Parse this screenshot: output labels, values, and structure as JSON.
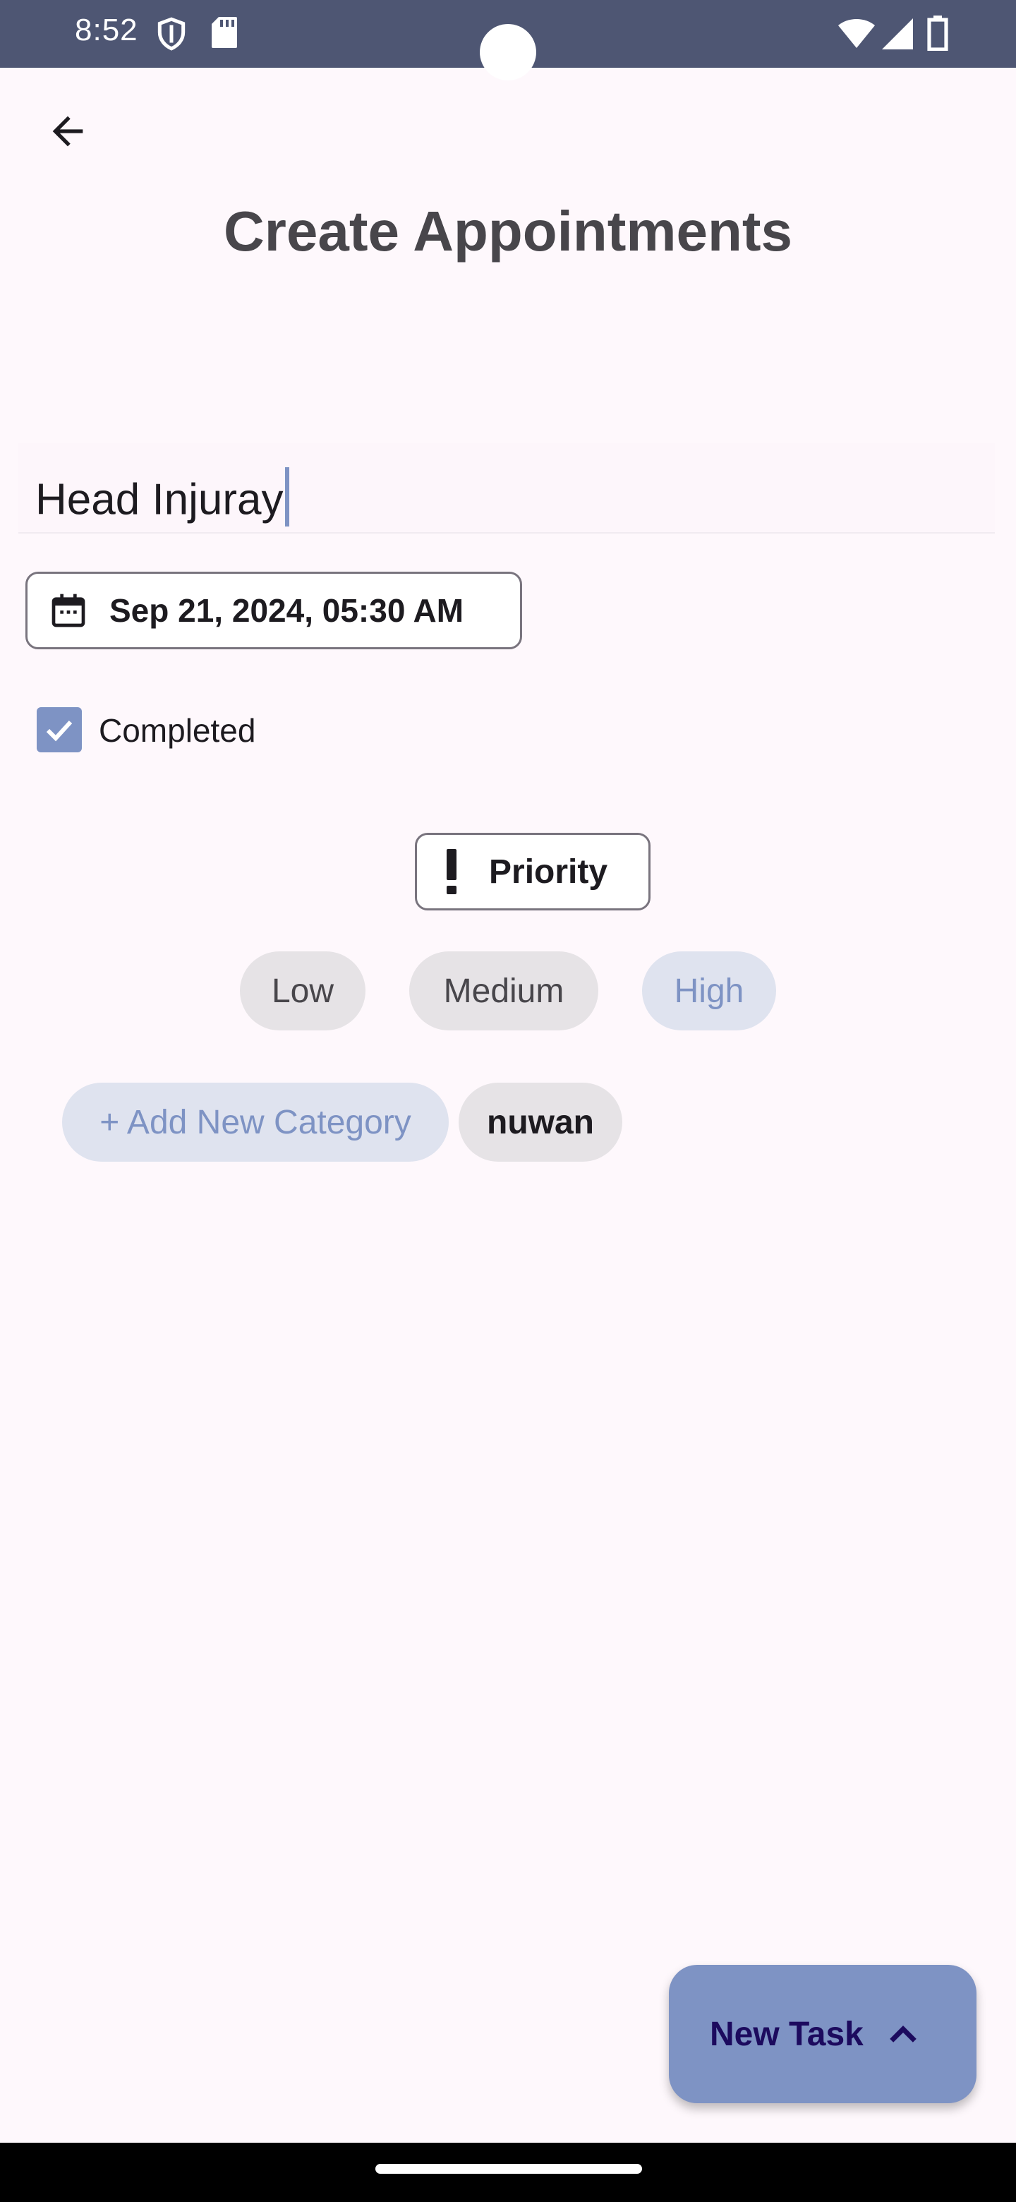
{
  "status_bar": {
    "time": "8:52",
    "left_icons": [
      "shield-icon",
      "sd-card-icon"
    ],
    "right_icons": [
      "wifi-icon",
      "signal-icon",
      "battery-icon"
    ]
  },
  "header": {
    "back_icon": "arrow-back-icon",
    "title": "Create Appointments"
  },
  "form": {
    "title_value": "Head Injuray",
    "date": {
      "icon": "calendar-icon",
      "label": "Sep 21, 2024, 05:30 AM"
    },
    "completed": {
      "checked": true,
      "label": "Completed"
    },
    "priority": {
      "icon": "exclamation-icon",
      "label": "Priority",
      "options": [
        "Low",
        "Medium",
        "High"
      ],
      "selected": "High"
    },
    "categories": {
      "add_label": "+ Add New Category",
      "items": [
        "nuwan"
      ]
    }
  },
  "fab": {
    "label": "New Task",
    "icon": "chevron-up-icon"
  },
  "colors": {
    "accent": "#7e93c4",
    "status_bar": "#4e5673",
    "background": "#fef8fc"
  }
}
